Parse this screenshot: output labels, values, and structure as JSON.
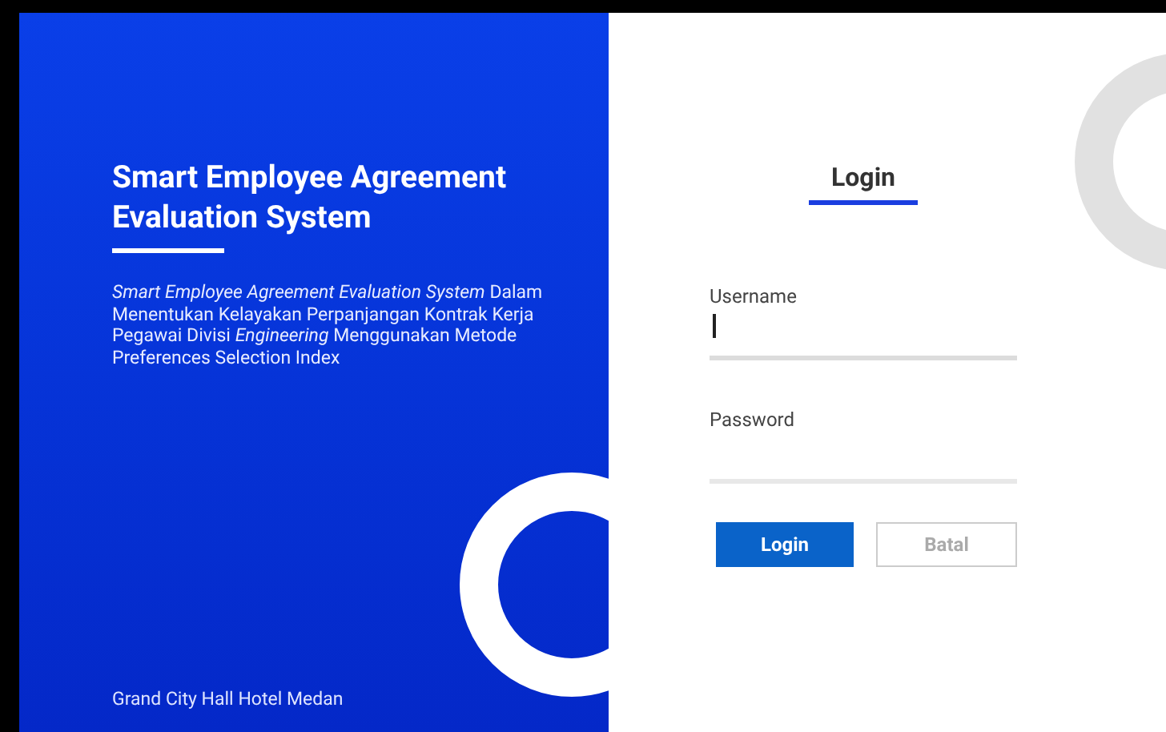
{
  "brand": {
    "title": "Smart Employee Agreement Evaluation System",
    "description": "*Smart Employee Agreement Evaluation System* Dalam Menentukan Kelayakan Perpanjangan Kontrak Kerja Pegawai Divisi *Engineering* Menggunakan Metode Preferences Selection Index",
    "footer": "Grand City Hall Hotel Medan"
  },
  "login": {
    "heading": "Login",
    "fields": [
      {
        "label": "Username",
        "focused": true
      },
      {
        "label": "Password",
        "focused": false
      }
    ],
    "buttons": [
      {
        "label": "Login",
        "kind": "primary"
      },
      {
        "label": "Batal",
        "kind": "secondary"
      }
    ]
  }
}
